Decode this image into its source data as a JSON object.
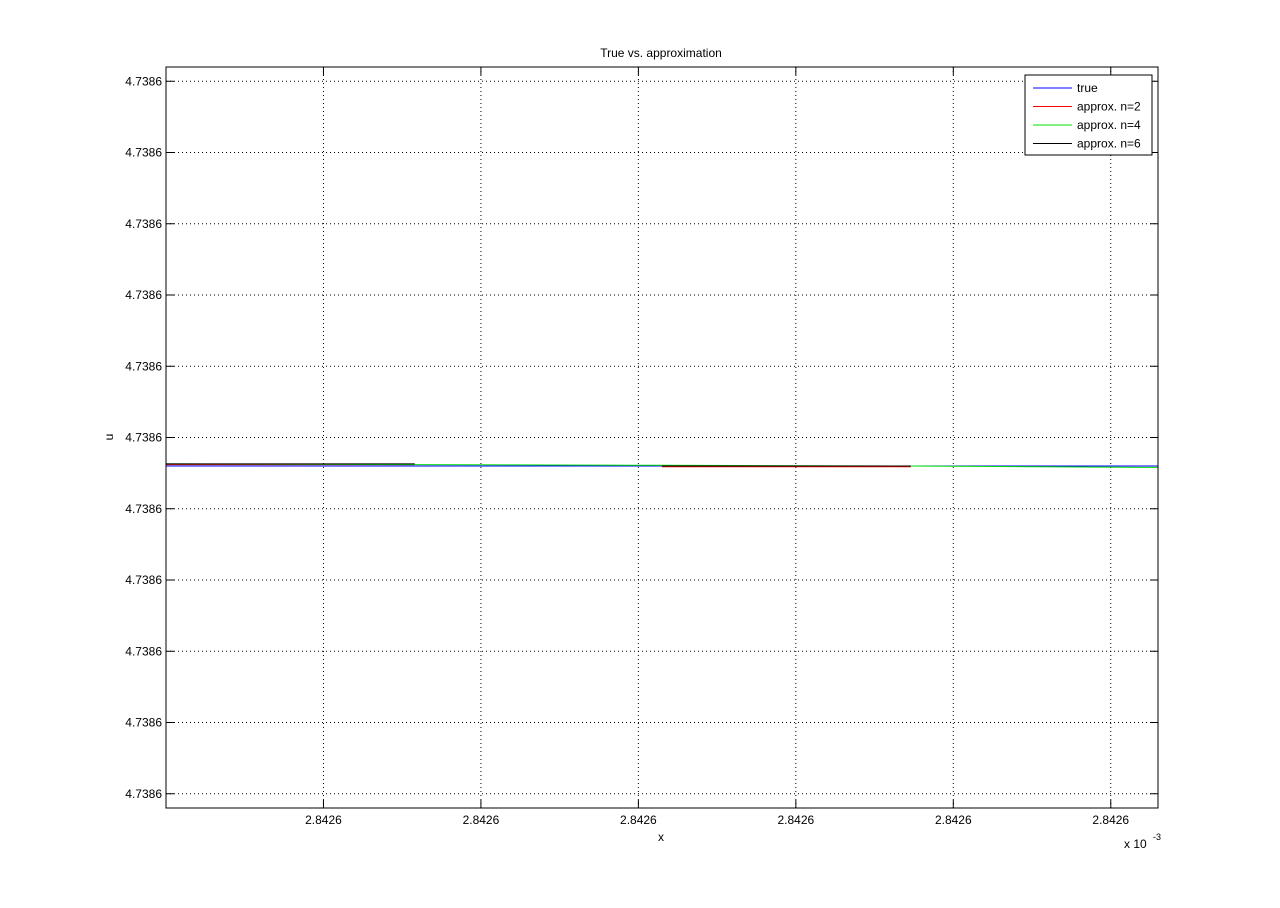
{
  "chart_data": {
    "type": "line",
    "title": "True vs. approximation",
    "xlabel": "x",
    "ylabel": "u",
    "x_multiplier": "x 10",
    "x_exponent": "-3",
    "xlim": [
      0,
      6.3
    ],
    "ylim": [
      -5.2,
      5.2
    ],
    "x_ticks": [
      1,
      2,
      3,
      4,
      5,
      6
    ],
    "x_tick_labels": [
      "2.8426",
      "2.8426",
      "2.8426",
      "2.8426",
      "2.8426",
      "2.8426"
    ],
    "y_ticks": [
      5,
      4,
      3,
      2,
      1,
      0,
      -1,
      -2,
      -3,
      -4,
      -5
    ],
    "y_tick_labels": [
      "4.7386",
      "4.7386",
      "4.7386",
      "4.7386",
      "4.7386",
      "4.7386",
      "4.7386",
      "4.7386",
      "4.7386",
      "4.7386",
      "4.7386"
    ],
    "grid": true,
    "legend_position": "top-right",
    "series": [
      {
        "name": "true",
        "color": "#0000ff",
        "x": [
          0,
          6.3
        ],
        "y": [
          -0.4,
          -0.4
        ]
      },
      {
        "name": "approx. n=2",
        "color": "#ff0000",
        "segments": [
          {
            "x": [
              0,
              1.58
            ],
            "y": [
              -0.38,
              -0.38
            ]
          },
          {
            "x": [
              3.15,
              4.73
            ],
            "y": [
              -0.41,
              -0.41
            ]
          }
        ]
      },
      {
        "name": "approx. n=4",
        "color": "#00e000",
        "x": [
          0,
          1.58,
          3.15,
          4.73,
          6.3
        ],
        "y": [
          -0.37,
          -0.38,
          -0.39,
          -0.4,
          -0.42
        ]
      },
      {
        "name": "approx. n=6",
        "color": "#000000",
        "segments": [
          {
            "x": [
              0,
              1.58
            ],
            "y": [
              -0.37,
              -0.37
            ]
          },
          {
            "x": [
              3.15,
              4.73
            ],
            "y": [
              -0.4,
              -0.4
            ]
          }
        ]
      }
    ]
  }
}
